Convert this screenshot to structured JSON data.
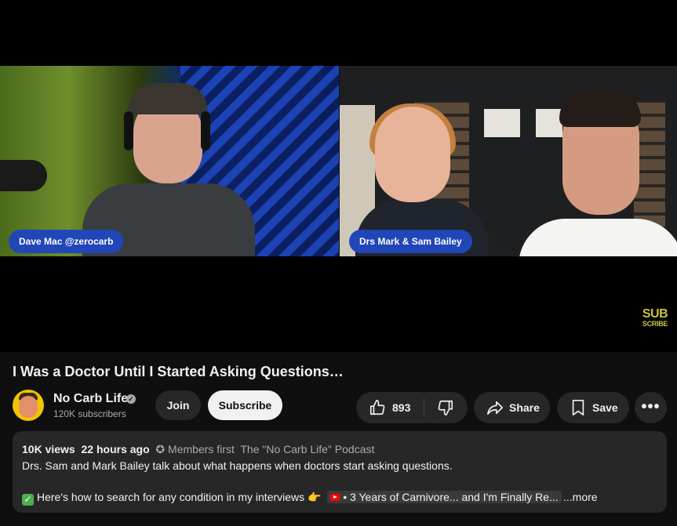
{
  "video": {
    "left_name_tag": "Dave Mac @zerocarb",
    "right_name_tag": "Drs Mark & Sam Bailey",
    "overlay_badge_line1": "SUB",
    "overlay_badge_line2": "SCRIBE"
  },
  "title": "I Was a Doctor Until I Started Asking Questions…",
  "channel": {
    "name": "No Carb Life",
    "subscribers": "120K subscribers",
    "verified_glyph": "✓"
  },
  "buttons": {
    "join": "Join",
    "subscribe": "Subscribe",
    "like_count": "893",
    "share": "Share",
    "save": "Save",
    "more": "•••"
  },
  "description": {
    "views": "10K views",
    "age": "22 hours ago",
    "members_first": "✪ Members first",
    "playlist": "The \"No Carb Life\" Podcast",
    "line1": "Drs. Sam and Mark Bailey talk about what happens when doctors start asking questions.",
    "line2_prefix": "Here's how to search for any condition in my interviews 👉",
    "line2_chip": "• 3 Years of Carnivore... and I'm Finally Re...",
    "more": "...more"
  },
  "icons": [
    "thumbs-up-icon",
    "thumbs-down-icon",
    "share-icon",
    "bookmark-icon",
    "more-horizontal-icon",
    "verified-icon",
    "checkmark-icon",
    "youtube-icon"
  ],
  "colors": {
    "background": "#0f0f0f",
    "pill": "#272727",
    "name_tag": "#2146b8",
    "subscribe_bg": "#f1f1f1",
    "badge": "#c8c437"
  }
}
